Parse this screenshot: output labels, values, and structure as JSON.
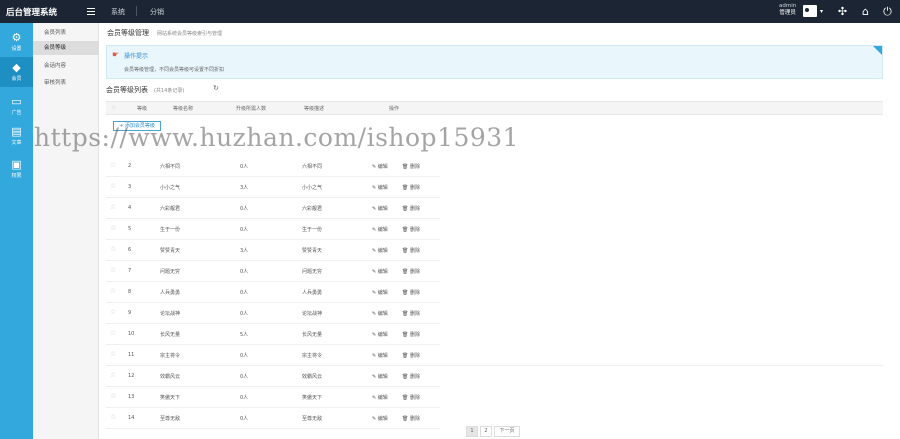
{
  "app": {
    "title": "后台管理系统"
  },
  "topnav": {
    "items": [
      {
        "label": "系统"
      },
      {
        "label": "分销"
      }
    ]
  },
  "user": {
    "name": "admin",
    "role": "管理员"
  },
  "topicons": [
    "grid-icon",
    "id-card-icon",
    "network-icon",
    "home-icon",
    "power-icon"
  ],
  "sidebar": {
    "items": [
      {
        "label": "设置",
        "icon": "gear-icon"
      },
      {
        "label": "会员",
        "icon": "diamond-icon"
      },
      {
        "label": "广告",
        "icon": "monitor-icon"
      },
      {
        "label": "文章",
        "icon": "chat-icon"
      },
      {
        "label": "权限",
        "icon": "lock-icon"
      }
    ]
  },
  "subnav": {
    "items": [
      {
        "label": "会员列表"
      },
      {
        "label": "会员等级"
      },
      {
        "label": "会话内容"
      },
      {
        "label": "审核列表"
      }
    ]
  },
  "page": {
    "title": "会员等级管理",
    "subtitle": "网站系统会员等级索引与管理"
  },
  "tips": {
    "title": "操作提示",
    "text": "会员等级管理，不同会员等级可设置不同折扣"
  },
  "list": {
    "title": "会员等级列表",
    "count": "(共14条记录)"
  },
  "table": {
    "columns": [
      "等级",
      "等级名称",
      "升级所需人数",
      "等级描述",
      "操作"
    ],
    "add_label": "添加会员等级",
    "rows": [
      {
        "id": "2",
        "name": "六相不同",
        "people": "0人",
        "desc": "六相不同",
        "edit": "编辑",
        "del": "删除"
      },
      {
        "id": "3",
        "name": "小小之气",
        "people": "3人",
        "desc": "小小之气",
        "edit": "编辑",
        "del": "删除"
      },
      {
        "id": "4",
        "name": "六彩靓君",
        "people": "0人",
        "desc": "六彩靓君",
        "edit": "编辑",
        "del": "删除"
      },
      {
        "id": "5",
        "name": "生于一份",
        "people": "0人",
        "desc": "生于一份",
        "edit": "编辑",
        "del": "删除"
      },
      {
        "id": "6",
        "name": "赞赞青天",
        "people": "3人",
        "desc": "赞赞青天",
        "edit": "编辑",
        "del": "删除"
      },
      {
        "id": "7",
        "name": "问题无穷",
        "people": "0人",
        "desc": "问题无穷",
        "edit": "编辑",
        "del": "删除"
      },
      {
        "id": "8",
        "name": "人兵勇勇",
        "people": "0人",
        "desc": "人兵勇勇",
        "edit": "编辑",
        "del": "删除"
      },
      {
        "id": "9",
        "name": "论坛战神",
        "people": "0人",
        "desc": "论坛战神",
        "edit": "编辑",
        "del": "删除"
      },
      {
        "id": "10",
        "name": "长风无量",
        "people": "5人",
        "desc": "长风无量",
        "edit": "编辑",
        "del": "删除"
      },
      {
        "id": "11",
        "name": "宗主将令",
        "people": "0人",
        "desc": "宗主将令",
        "edit": "编辑",
        "del": "删除"
      },
      {
        "id": "12",
        "name": "效霸风云",
        "people": "0人",
        "desc": "效霸风云",
        "edit": "编辑",
        "del": "删除"
      },
      {
        "id": "13",
        "name": "笑傲天下",
        "people": "0人",
        "desc": "笑傲天下",
        "edit": "编辑",
        "del": "删除"
      },
      {
        "id": "14",
        "name": "至尊无敌",
        "people": "0人",
        "desc": "至尊无敌",
        "edit": "编辑",
        "del": "删除"
      }
    ]
  },
  "pagination": {
    "pages": [
      "1",
      "2"
    ],
    "next": "下一页"
  },
  "watermark": "https://www.huzhan.com/ishop15931",
  "colors": {
    "topbar": "#1b2533",
    "sidebar": "#32a8dc",
    "accent": "#2d8fd0"
  }
}
